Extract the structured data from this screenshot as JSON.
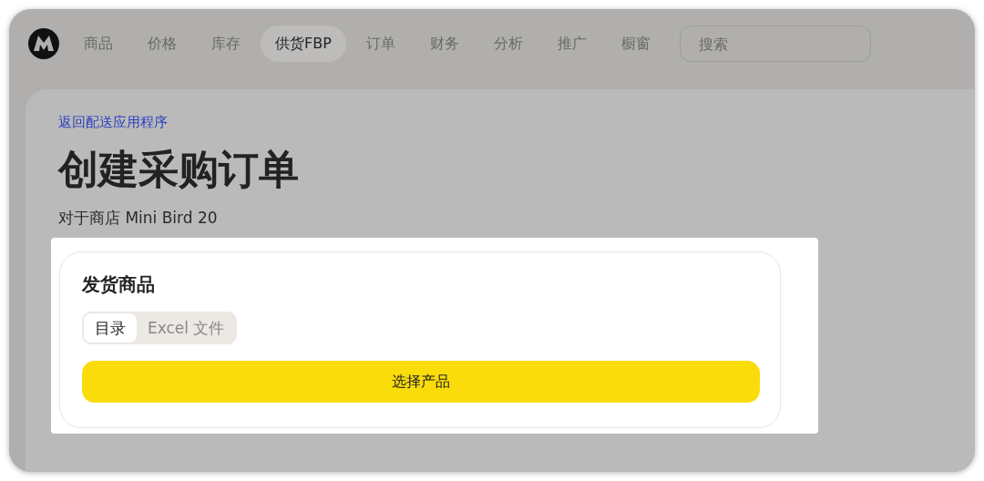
{
  "nav": {
    "tabs": [
      {
        "label": "商品",
        "selected": false
      },
      {
        "label": "价格",
        "selected": false
      },
      {
        "label": "库存",
        "selected": false
      },
      {
        "label": "供货FBP",
        "selected": true
      },
      {
        "label": "订单",
        "selected": false
      },
      {
        "label": "财务",
        "selected": false
      },
      {
        "label": "分析",
        "selected": false
      },
      {
        "label": "推广",
        "selected": false
      },
      {
        "label": "橱窗",
        "selected": false
      }
    ],
    "search": {
      "placeholder": "搜索"
    }
  },
  "page": {
    "back_link": "返回配送应用程序",
    "title": "创建采购订单",
    "subtitle": "对于商店 Mini Bird 20"
  },
  "card": {
    "title": "发货商品",
    "source_tabs": [
      {
        "label": "目录",
        "selected": true
      },
      {
        "label": "Excel 文件",
        "selected": false
      }
    ],
    "button": "选择产品"
  }
}
